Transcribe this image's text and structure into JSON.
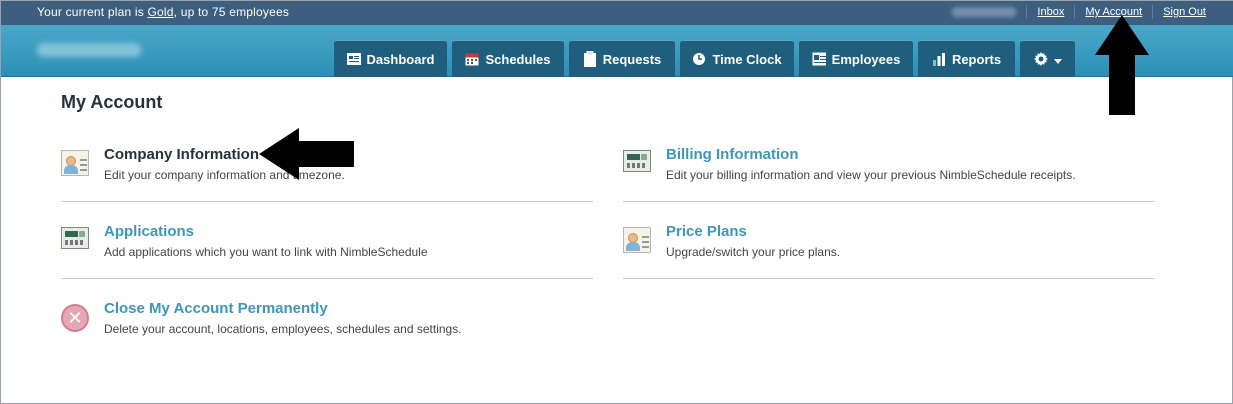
{
  "topbar": {
    "plan_prefix": "Your current plan is ",
    "plan_name": "Gold",
    "plan_suffix": ", up to 75 employees",
    "links": {
      "inbox": "Inbox",
      "my_account": "My Account",
      "sign_out": "Sign Out"
    }
  },
  "nav": {
    "tabs": [
      {
        "label": "Dashboard",
        "icon": "dashboard-icon"
      },
      {
        "label": "Schedules",
        "icon": "calendar-icon"
      },
      {
        "label": "Requests",
        "icon": "clipboard-icon"
      },
      {
        "label": "Time Clock",
        "icon": "clock-icon"
      },
      {
        "label": "Employees",
        "icon": "id-card-icon"
      },
      {
        "label": "Reports",
        "icon": "bar-chart-icon"
      }
    ],
    "settings_icon": "gear-icon"
  },
  "page": {
    "title": "My Account",
    "items": [
      {
        "title": "Company Information",
        "desc": "Edit your company information and timezone."
      },
      {
        "title": "Billing Information",
        "desc": "Edit your billing information and view your previous NimbleSchedule receipts."
      },
      {
        "title": "Applications",
        "desc": "Add applications which you want to link with NimbleSchedule"
      },
      {
        "title": "Price Plans",
        "desc": "Upgrade/switch your price plans."
      },
      {
        "title": "Close My Account Permanently",
        "desc": "Delete your account, locations, employees, schedules and settings."
      }
    ]
  },
  "colors": {
    "topbar": "#3d5f7f",
    "navbar": "#2d8fb6",
    "tab": "#1f5f7d",
    "link": "#3e97b8"
  }
}
